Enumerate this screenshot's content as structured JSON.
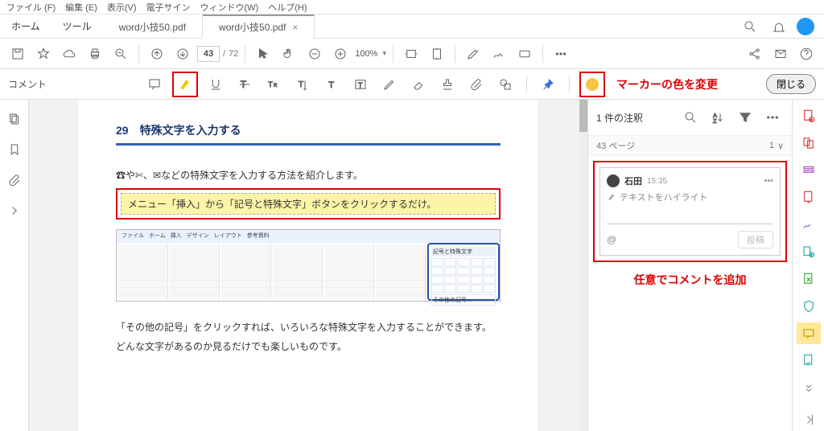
{
  "menu": {
    "file": "ファイル (F)",
    "edit": "編集 (E)",
    "view": "表示(V)",
    "sign": "電子サイン",
    "window": "ウィンドウ(W)",
    "help": "ヘルプ(H)"
  },
  "tabs": {
    "home": "ホーム",
    "tools": "ツール",
    "file1": "word小技50.pdf",
    "file2": "word小技50.pdf"
  },
  "toolbar": {
    "page": "43",
    "page_sep": "/",
    "pages_total": "72",
    "zoom": "100%"
  },
  "commentbar": {
    "label": "コメント",
    "close": "閉じる"
  },
  "annotation": {
    "marker": "マーカーの色を変更",
    "addcomment": "任意でコメントを追加"
  },
  "document": {
    "section_num": "29",
    "section_title": "特殊文字を入力する",
    "intro": "☎や✄、✉などの特殊文字を入力する方法を紹介します。",
    "highlighted": "メニュー「挿入」から「記号と特殊文字」ボタンをクリックするだけ。",
    "para1": "「その他の記号」をクリックすれば、いろいろな特殊文字を入力することができます。",
    "para2": "どんな文字があるのか見るだけでも楽しいものです。"
  },
  "comments": {
    "header": "1 件の注釈",
    "pageLabel": "43 ページ",
    "pageCount": "1",
    "author": "石田",
    "time": "15:35",
    "type": "テキストをハイライト",
    "post": "投稿"
  },
  "icons": {
    "at": "@",
    "chevron": "∨",
    "dots": "•••"
  }
}
